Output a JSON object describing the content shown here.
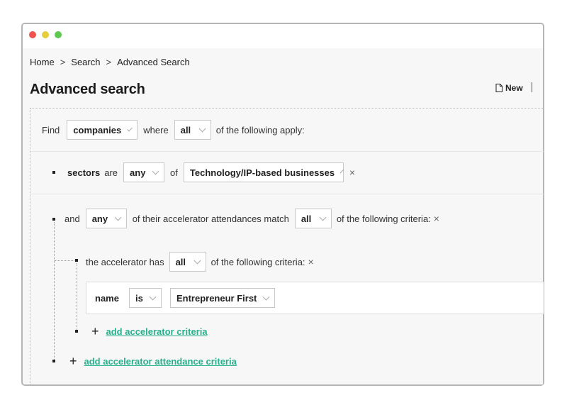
{
  "window": {
    "traffic_lights": [
      "close",
      "minimize",
      "maximize"
    ]
  },
  "breadcrumb": {
    "items": [
      "Home",
      "Search",
      "Advanced Search"
    ],
    "separator": ">"
  },
  "page": {
    "title": "Advanced search",
    "new_label": "New"
  },
  "query": {
    "find_label": "Find",
    "entity_select": "companies",
    "where_label": "where",
    "match_select": "all",
    "apply_text": "of the following apply:"
  },
  "sector_rule": {
    "field": "sectors",
    "verb": "are",
    "quantifier": "any",
    "of_label": "of",
    "value": "Technology/IP-based businesses",
    "remove": "×"
  },
  "accelerator_rule": {
    "and_label": "and",
    "quantifier": "any",
    "middle_text": "of their accelerator attendances match",
    "match_select": "all",
    "suffix_text": "of the following criteria:",
    "remove": "×"
  },
  "accelerator_sub": {
    "prefix_text": "the accelerator has",
    "match_select": "all",
    "suffix_text": "of the following criteria:",
    "remove": "×",
    "criteria": {
      "field": "name",
      "operator": "is",
      "value": "Entrepreneur First"
    },
    "add_label": "add accelerator criteria"
  },
  "add_attendance_label": "add accelerator attendance criteria",
  "colors": {
    "link": "#27b08c",
    "close": "#f0524f",
    "minimize": "#e6cd3a",
    "maximize": "#5cc84e"
  }
}
